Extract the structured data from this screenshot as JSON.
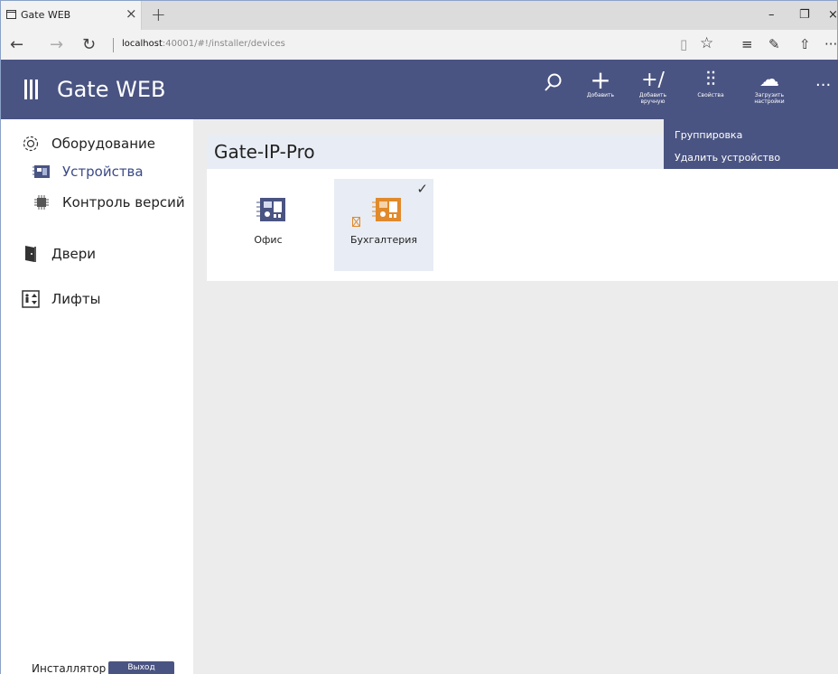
{
  "browser": {
    "tab_title": "Gate WEB",
    "tab_close": "×",
    "new_tab": "+",
    "minimize": "–",
    "restore": "❐",
    "close": "×",
    "back": "←",
    "forward": "→",
    "refresh": "↻",
    "url_host": "localhost",
    "url_path": ":40001/#!/installer/devices",
    "reading_view": "▯",
    "favorite": "☆",
    "hub": "≡",
    "notes": "✎",
    "share": "⇧",
    "more": "···"
  },
  "header": {
    "app_title": "Gate WEB",
    "search_icon": "⚲",
    "buttons": [
      {
        "symbol": "+",
        "label": "Добавить"
      },
      {
        "symbol": "+∕",
        "label": "Добавить вручную"
      },
      {
        "symbol": "⫶⫶",
        "label": "Свойства"
      },
      {
        "symbol": "☁",
        "label": "Загрузить настройки"
      }
    ],
    "more": "···"
  },
  "sidebar": {
    "items": [
      {
        "label": "Оборудование",
        "icon": "gear-icon"
      },
      {
        "label": "Устройства",
        "icon": "device-board-icon"
      },
      {
        "label": "Контроль версий",
        "icon": "chip-icon"
      },
      {
        "label": "Двери",
        "icon": "door-icon"
      },
      {
        "label": "Лифты",
        "icon": "elevator-icon"
      }
    ],
    "footer_user": "Инсталлятор",
    "logout_label": "Выход"
  },
  "main": {
    "panel_title": "Gate-IP-Pro",
    "devices": [
      {
        "label": "Офис",
        "selected": false,
        "color": "#4a5482"
      },
      {
        "label": "Бухгалтерия",
        "selected": true,
        "color": "#e08a2c"
      }
    ],
    "check_mark": "✓"
  },
  "dropdown": {
    "items": [
      "Группировка",
      "Удалить устройство"
    ]
  },
  "colors": {
    "accent": "#4a5482",
    "warning_device": "#e08a2c",
    "content_bg": "#ececec"
  }
}
